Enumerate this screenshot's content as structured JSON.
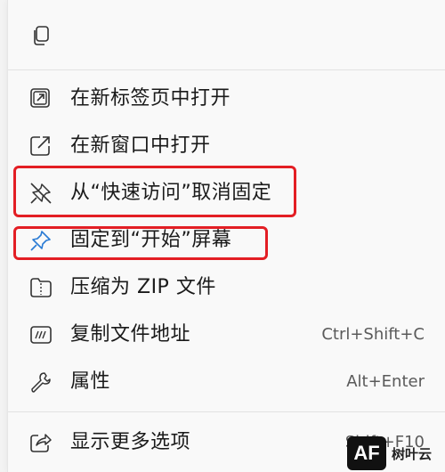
{
  "menu": {
    "items": [
      {
        "label": "在新标签页中打开",
        "icon": "open-new-tab-icon",
        "shortcut": ""
      },
      {
        "label": "在新窗口中打开",
        "icon": "open-new-window-icon",
        "shortcut": ""
      },
      {
        "label": "从“快速访问”取消固定",
        "icon": "unpin-icon",
        "shortcut": ""
      },
      {
        "label": "固定到“开始”屏幕",
        "icon": "pin-icon",
        "shortcut": ""
      },
      {
        "label": "压缩为 ZIP 文件",
        "icon": "zip-folder-icon",
        "shortcut": ""
      },
      {
        "label": "复制文件地址",
        "icon": "copy-path-icon",
        "shortcut": "Ctrl+Shift+C"
      },
      {
        "label": "属性",
        "icon": "wrench-icon",
        "shortcut": "Alt+Enter"
      },
      {
        "label": "显示更多选项",
        "icon": "share-icon",
        "shortcut": "Shift+F10"
      }
    ]
  },
  "watermark": {
    "logo": "AF",
    "text": "树叶云"
  },
  "colors": {
    "highlight": "#e31e24",
    "icon": "#333333",
    "menu_bg": "#f9f9f9"
  }
}
